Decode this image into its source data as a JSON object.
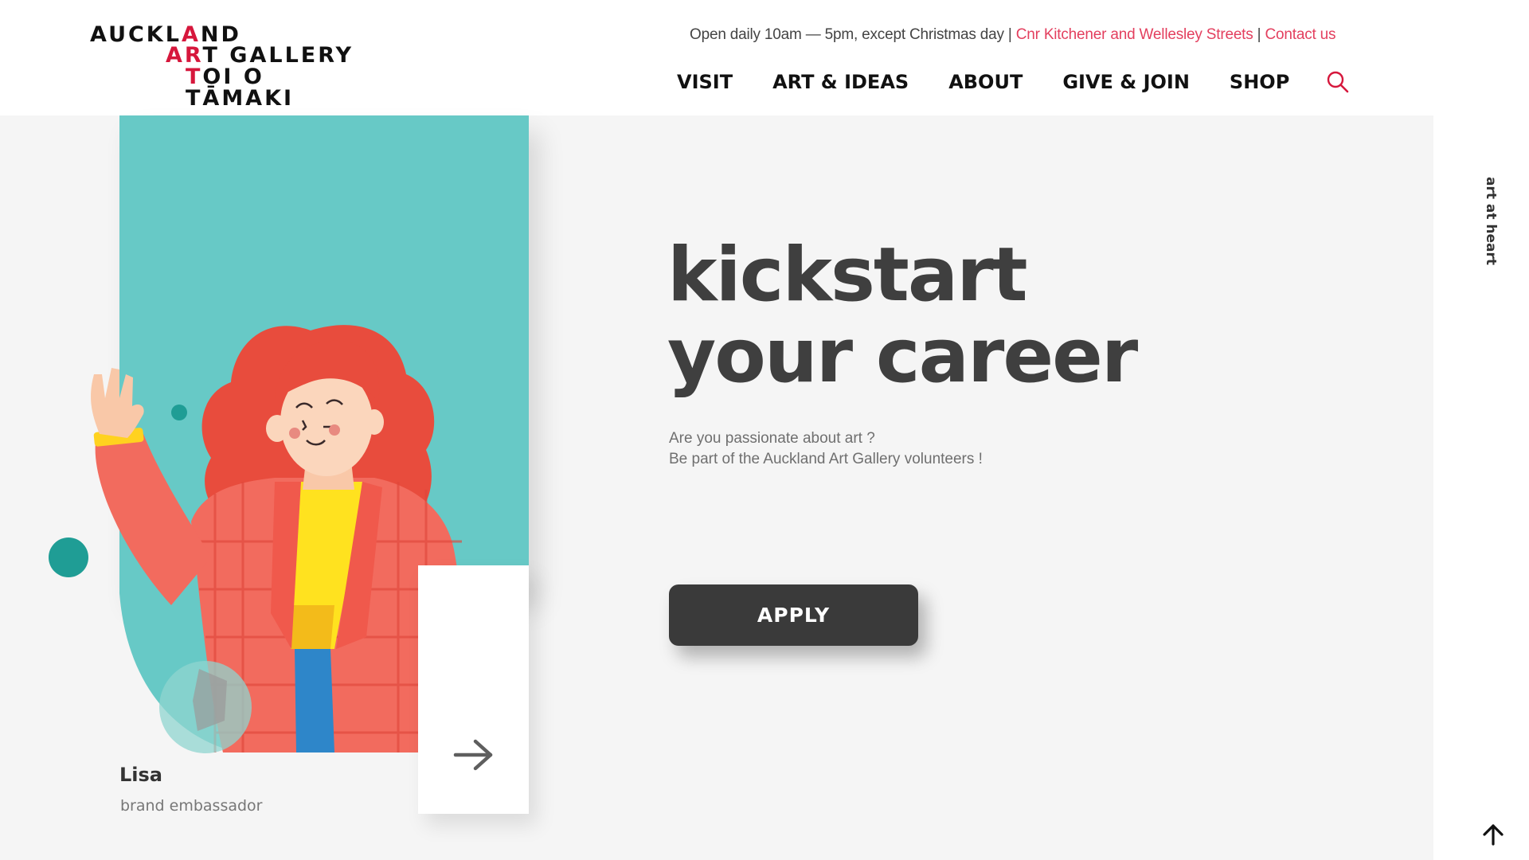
{
  "header": {
    "logo": {
      "line1_a": "AUCKL",
      "line1_red": "A",
      "line1_b": "ND",
      "line2_red": "AR",
      "line2_b": "T GALLERY",
      "line3_red": "T",
      "line3_b": "OI O TĀMAKI"
    },
    "info": {
      "hours": "Open daily 10am — 5pm, except Christmas day |",
      "location_link": "Cnr Kitchener and Wellesley Streets",
      "separator": "|",
      "contact_link": "Contact us"
    },
    "nav": [
      {
        "label": "VISIT"
      },
      {
        "label": "ART & IDEAS"
      },
      {
        "label": "ABOUT"
      },
      {
        "label": "GIVE & JOIN"
      },
      {
        "label": "SHOP"
      }
    ],
    "search_icon": "search-icon"
  },
  "hero": {
    "headline_line1": "kickstart",
    "headline_line2": "your career",
    "sub_line1": "Are you passionate about art ?",
    "sub_line2": "Be part of the Auckland Art Gallery volunteers !",
    "apply_label": "APPLY",
    "person": {
      "name": "Lisa",
      "role": "brand embassador"
    },
    "next_icon": "arrow-right-icon"
  },
  "side": {
    "tagline": "art at heart",
    "top_icon": "arrow-up-icon"
  },
  "colors": {
    "accent_red": "#d6173c",
    "link_pink": "#e33f5e",
    "teal": "#67c9c6",
    "button_dark": "#3a3a3a"
  }
}
